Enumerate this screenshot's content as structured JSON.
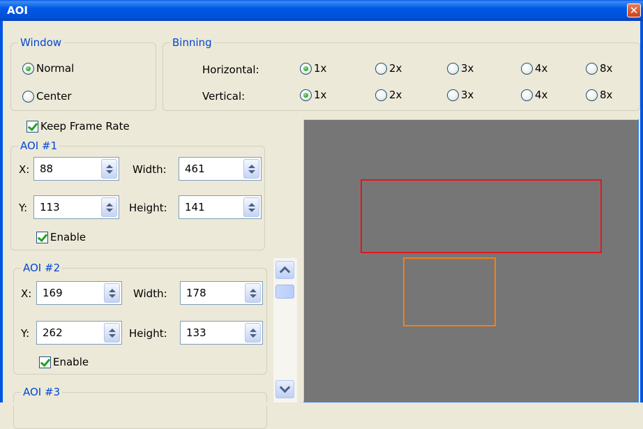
{
  "window": {
    "title": "AOI",
    "close_glyph": "✕"
  },
  "window_group": {
    "legend": "Window",
    "options": [
      "Normal",
      "Center"
    ],
    "selected": "Normal"
  },
  "binning": {
    "legend": "Binning",
    "horizontal": {
      "label": "Horizontal:",
      "options": [
        "1x",
        "2x",
        "3x",
        "4x",
        "8x"
      ],
      "selected": "1x"
    },
    "vertical": {
      "label": "Vertical:",
      "options": [
        "1x",
        "2x",
        "3x",
        "4x",
        "8x"
      ],
      "selected": "1x"
    }
  },
  "keep_frame_rate": {
    "label": "Keep Frame Rate",
    "checked": true
  },
  "aois": [
    {
      "legend": "AOI #1",
      "x_label": "X:",
      "x": "88",
      "width_label": "Width:",
      "width": "461",
      "y_label": "Y:",
      "y": "113",
      "height_label": "Height:",
      "height": "141",
      "enable_label": "Enable",
      "enabled": true,
      "color": "#e8141e"
    },
    {
      "legend": "AOI #2",
      "x_label": "X:",
      "x": "169",
      "width_label": "Width:",
      "width": "178",
      "y_label": "Y:",
      "y": "262",
      "height_label": "Height:",
      "height": "133",
      "enable_label": "Enable",
      "enabled": true,
      "color": "#f0801e"
    },
    {
      "legend": "AOI #3"
    }
  ],
  "preview": {
    "background": "#767676"
  }
}
